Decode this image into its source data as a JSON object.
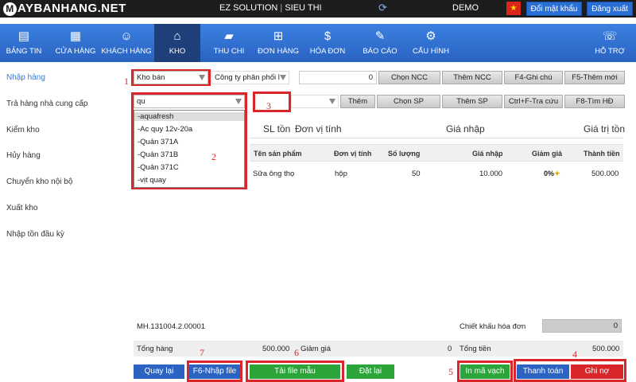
{
  "header": {
    "logo_initial": "M",
    "logo_text": "AYBANHANG.NET",
    "solution": "EZ SOLUTION",
    "solution_sep": "|",
    "solution_sub": "SIEU THI",
    "demo": "DEMO",
    "change_password": "Đổi mật khẩu",
    "logout": "Đăng xuất"
  },
  "nav": [
    {
      "label": "BẢNG TIN",
      "icon": "chart-icon"
    },
    {
      "label": "CỬA HÀNG",
      "icon": "store-icon"
    },
    {
      "label": "KHÁCH HÀNG",
      "icon": "customers-icon"
    },
    {
      "label": "KHO",
      "icon": "home-icon"
    },
    {
      "label": "THU CHI",
      "icon": "money-icon"
    },
    {
      "label": "ĐƠN HÀNG",
      "icon": "cart-icon"
    },
    {
      "label": "HÓA ĐƠN",
      "icon": "invoice-icon"
    },
    {
      "label": "BÁO CÁO",
      "icon": "report-icon"
    },
    {
      "label": "CẤU HÌNH",
      "icon": "gear-icon"
    },
    {
      "label": "HỖ TRỢ",
      "icon": "support-icon"
    }
  ],
  "sidebar": [
    "Nhập hàng",
    "Trả hàng nhà cung cấp",
    "Kiểm kho",
    "Hủy hàng",
    "Chuyển kho nội bộ",
    "Xuất kho",
    "Nhập tồn đầu kỳ"
  ],
  "form": {
    "warehouse": "Kho bán",
    "supplier": "Công ty phân phối l",
    "supplier_amount": "0",
    "btn_choose_supplier": "Chọn NCC",
    "btn_add_supplier": "Thêm NCC",
    "btn_note": "F4-Ghi chú",
    "btn_new": "F5-Thêm mới",
    "search_value": "qu",
    "btn_add": "Thêm",
    "btn_choose_product": "Chọn SP",
    "btn_add_product": "Thêm SP",
    "btn_lookup": "Ctrl+F-Tra cứu",
    "btn_find_invoice": "F8-Tìm HĐ"
  },
  "dropdown": [
    "-aquafresh",
    "-Ac quy 12v-20a",
    "-Quản 371A",
    "-Quản 371B",
    "-Quản 371C",
    "-vịt quay"
  ],
  "entry_headers": {
    "stock": "SL tồn",
    "unit": "Đơn vị tính",
    "price": "Giá nhập",
    "value": "Giá trị tồn"
  },
  "table": {
    "headers": [
      "Tên sản phẩm",
      "Đơn vị tính",
      "Số lượng",
      "Giá nhập",
      "Giảm giá",
      "Thành tiền"
    ],
    "rows": [
      {
        "name": "Sữa ông thọ",
        "unit": "hộp",
        "qty": "50",
        "price": "10.000",
        "discount": "0%",
        "total": "500.000"
      }
    ]
  },
  "footer": {
    "code": "MH.131004.2.00001",
    "invoice_discount_label": "Chiết khấu hóa đơn",
    "invoice_discount_value": "0",
    "total_goods_label": "Tổng hàng",
    "total_goods_value": "500.000",
    "discount_label": "Giảm giá",
    "discount_value": "0",
    "total_money_label": "Tổng tiền",
    "total_money_value": "500.000"
  },
  "actions": {
    "back": "Quay lại",
    "import_file": "F6-Nhập file",
    "download_template": "Tải file mẫu",
    "reset": "Đặt lại",
    "print_barcode": "In mã vạch",
    "pay": "Thanh toán",
    "debt": "Ghi nợ"
  },
  "annotations": [
    "1",
    "2",
    "3",
    "4",
    "5",
    "6",
    "7"
  ],
  "colors": {
    "accent": "#2a63c2",
    "annotation": "#d8262b",
    "success": "#2ba53a"
  }
}
